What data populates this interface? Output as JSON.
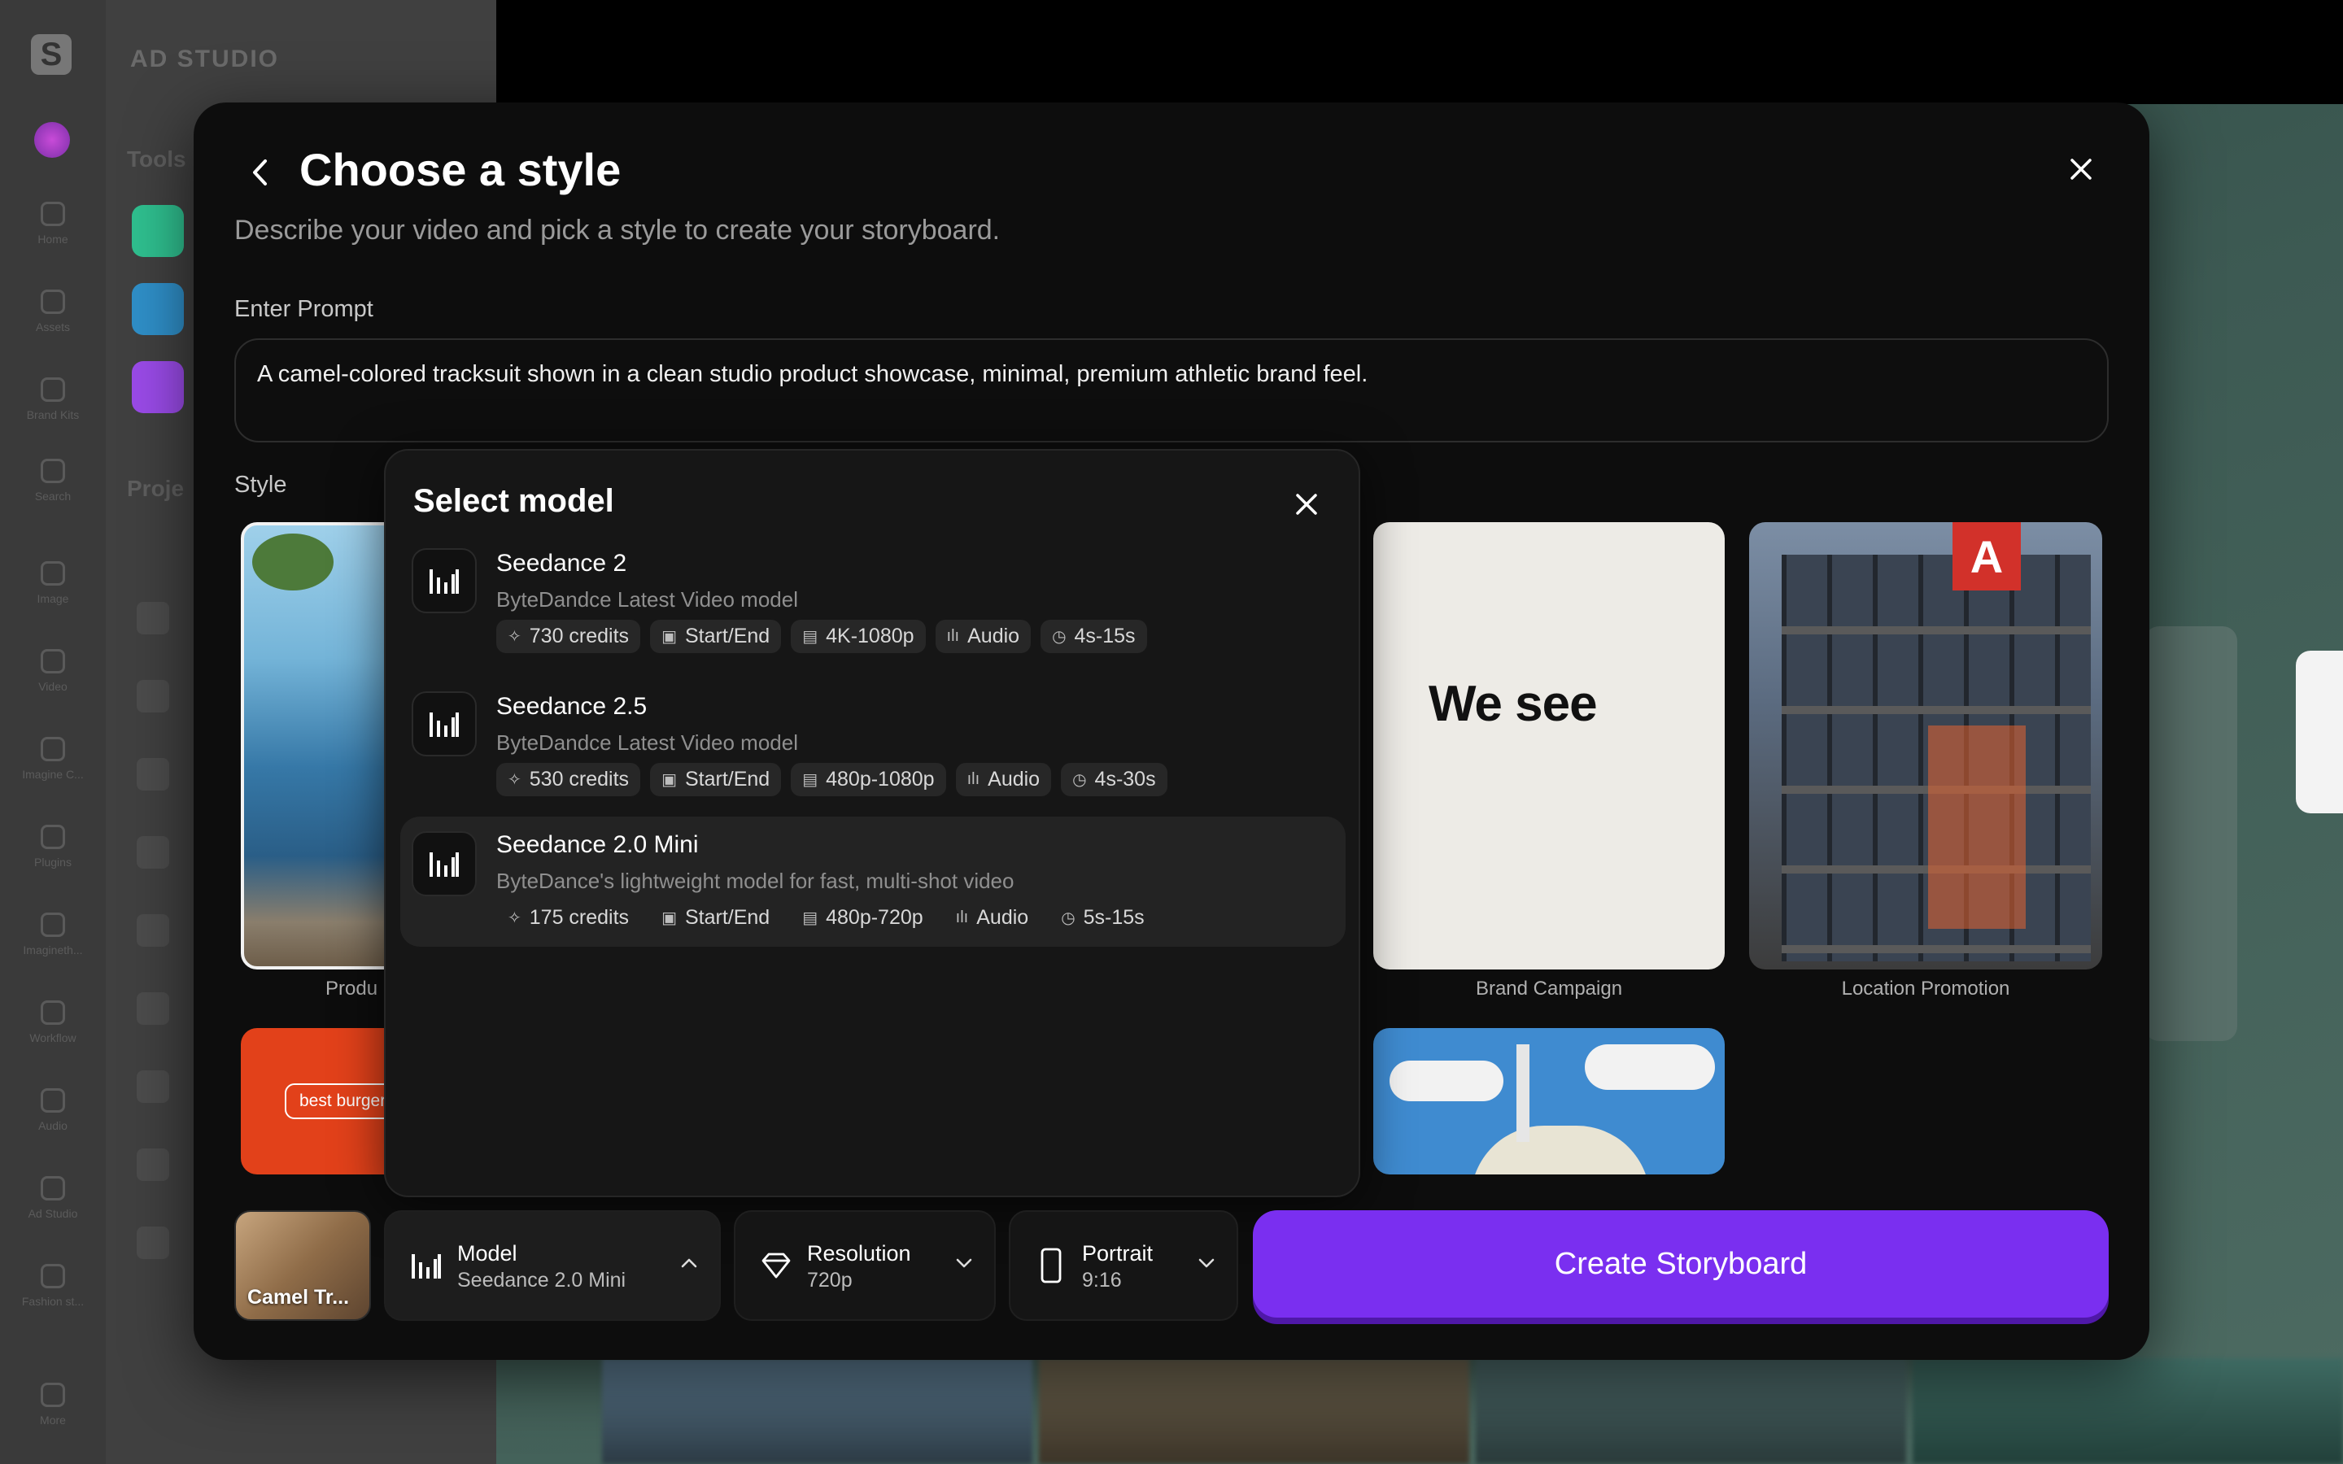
{
  "background": {
    "app_title": "AD STUDIO",
    "tools_label": "Tools",
    "projects_label": "Proje",
    "rail_items": [
      "Home",
      "Assets",
      "Brand Kits",
      "Search",
      "Image",
      "Video",
      "Imagine C...",
      "Plugins",
      "Imagineth...",
      "Workflow",
      "Audio",
      "Ad Studio",
      "Fashion st...",
      "More"
    ]
  },
  "modal": {
    "title": "Choose a style",
    "subtitle": "Describe your video and pick a style to create your storyboard.",
    "prompt_label": "Enter Prompt",
    "prompt_value": "A camel-colored tracksuit shown in a clean studio product showcase, minimal, premium athletic brand feel.",
    "style_label": "Style",
    "styles": [
      {
        "label": "Produ",
        "text": ""
      },
      {
        "label": "Brand Campaign",
        "text": "We see"
      },
      {
        "label": "Location Promotion",
        "text": ""
      },
      {
        "label": "",
        "text": "best burger"
      }
    ]
  },
  "model_popover": {
    "title": "Select model",
    "models": [
      {
        "name": "Seedance 2",
        "description": "ByteDandce Latest Video model",
        "credits": "730 credits",
        "frames": "Start/End",
        "resolution": "4K-1080p",
        "audio": "Audio",
        "duration": "4s-15s",
        "selected": false
      },
      {
        "name": "Seedance 2.5",
        "description": "ByteDandce Latest Video model",
        "credits": "530 credits",
        "frames": "Start/End",
        "resolution": "480p-1080p",
        "audio": "Audio",
        "duration": "4s-30s",
        "selected": false
      },
      {
        "name": "Seedance 2.0 Mini",
        "description": "ByteDance's lightweight model for fast, multi-shot video",
        "credits": "175 credits",
        "frames": "Start/End",
        "resolution": "480p-720p",
        "audio": "Audio",
        "duration": "5s-15s",
        "selected": true
      }
    ]
  },
  "bottom_bar": {
    "thumbnail_label": "Camel Tr...",
    "model_label": "Model",
    "model_value": "Seedance 2.0 Mini",
    "resolution_label": "Resolution",
    "resolution_value": "720p",
    "orientation_label": "Portrait",
    "orientation_value": "9:16",
    "create_label": "Create Storyboard"
  },
  "colors": {
    "accent": "#7a2ff0",
    "modal_bg": "#0d0d0d",
    "popover_bg": "#161616"
  }
}
